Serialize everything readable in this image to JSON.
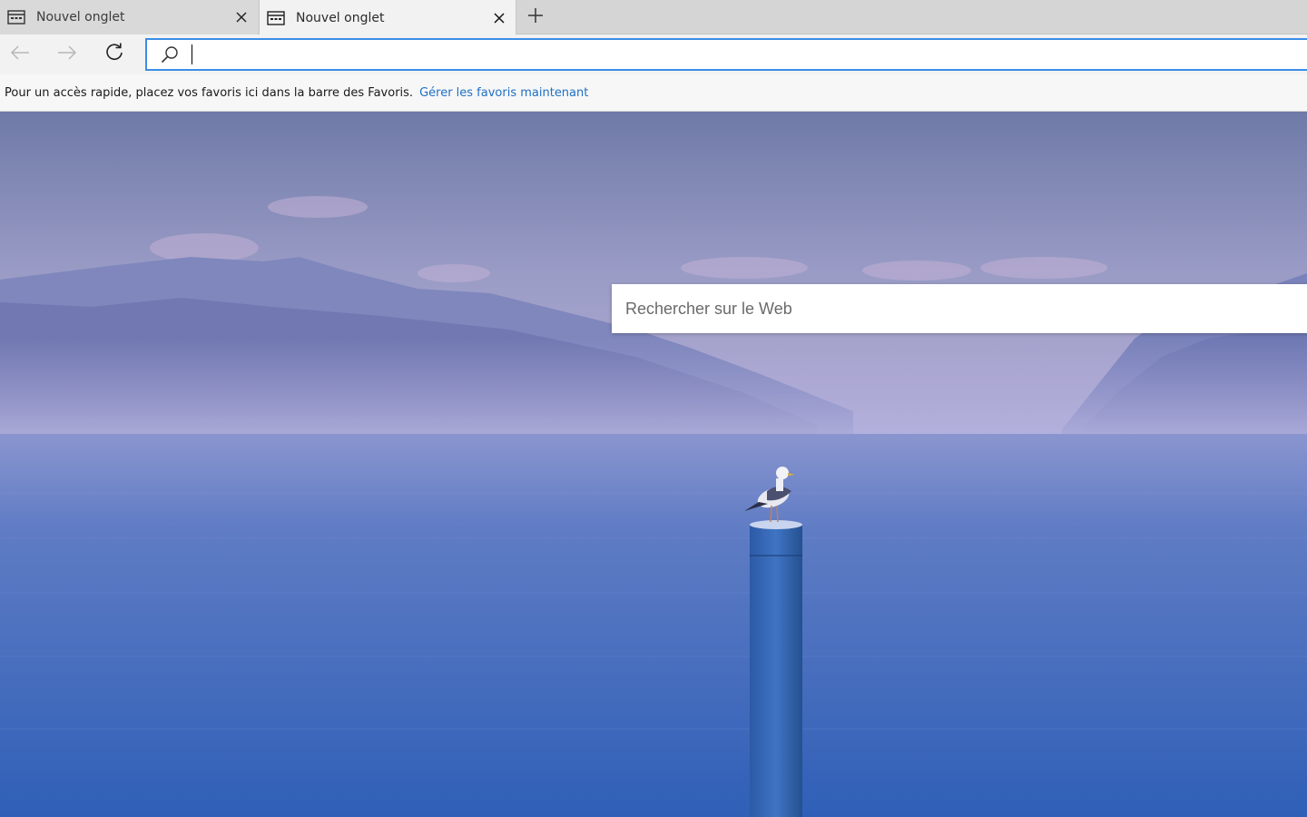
{
  "tabs": [
    {
      "title": "Nouvel onglet",
      "active": false
    },
    {
      "title": "Nouvel onglet",
      "active": true
    }
  ],
  "icons": {
    "tab_favicon": "newtab-page-icon",
    "tab_close": "close-icon",
    "new_tab": "plus-icon",
    "back": "arrow-left-icon",
    "forward": "arrow-right-icon",
    "refresh": "refresh-icon",
    "address_search": "search-icon"
  },
  "address_bar": {
    "value": ""
  },
  "favorites_bar": {
    "message": "Pour un accès rapide, placez vos favoris ici dans la barre des Favoris.",
    "link": "Gérer les favoris maintenant"
  },
  "new_tab_page": {
    "search_placeholder": "Rechercher sur le Web"
  },
  "colors": {
    "accent": "#3a8ee6",
    "link": "#1f6fc5",
    "sky_top": "#6c78a8",
    "water": "#3a66b8"
  }
}
